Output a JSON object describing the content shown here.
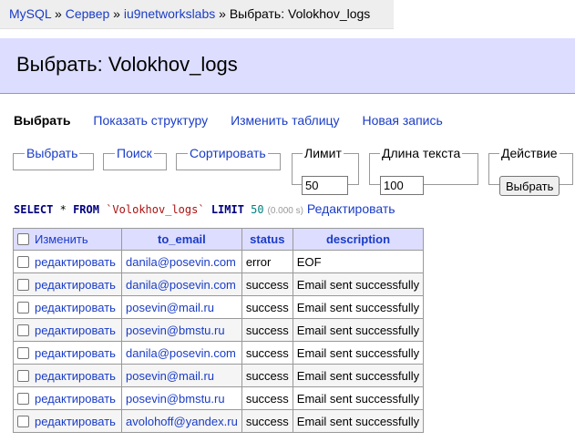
{
  "breadcrumb": {
    "items": [
      "MySQL",
      "Сервер",
      "iu9networkslabs"
    ],
    "separator": "»",
    "current": "Выбрать: Volokhov_logs"
  },
  "header": {
    "title": "Выбрать: Volokhov_logs"
  },
  "nav": {
    "active": "Выбрать",
    "links": [
      "Показать структуру",
      "Изменить таблицу",
      "Новая запись"
    ]
  },
  "filters": {
    "select_legend": "Выбрать",
    "search_legend": "Поиск",
    "sort_legend": "Сортировать",
    "limit_legend": "Лимит",
    "limit_value": "50",
    "textlen_legend": "Длина текста",
    "textlen_value": "100",
    "action_legend": "Действие",
    "action_button": "Выбрать"
  },
  "query": {
    "select": "SELECT",
    "star": "*",
    "from": "FROM",
    "table": "`Volokhov_logs`",
    "limit": "LIMIT",
    "limit_value": "50",
    "time": "(0.000 s)",
    "edit_link": "Редактировать"
  },
  "table": {
    "columns": [
      "Изменить",
      "to_email",
      "status",
      "description"
    ],
    "edit_label": "редактировать",
    "rows": [
      {
        "to_email": "danila@posevin.com",
        "status": "error",
        "description": "EOF"
      },
      {
        "to_email": "danila@posevin.com",
        "status": "success",
        "description": "Email sent successfully"
      },
      {
        "to_email": "posevin@mail.ru",
        "status": "success",
        "description": "Email sent successfully"
      },
      {
        "to_email": "posevin@bmstu.ru",
        "status": "success",
        "description": "Email sent successfully"
      },
      {
        "to_email": "danila@posevin.com",
        "status": "success",
        "description": "Email sent successfully"
      },
      {
        "to_email": "posevin@mail.ru",
        "status": "success",
        "description": "Email sent successfully"
      },
      {
        "to_email": "posevin@bmstu.ru",
        "status": "success",
        "description": "Email sent successfully"
      },
      {
        "to_email": "avolohoff@yandex.ru",
        "status": "success",
        "description": "Email sent successfully"
      }
    ]
  }
}
